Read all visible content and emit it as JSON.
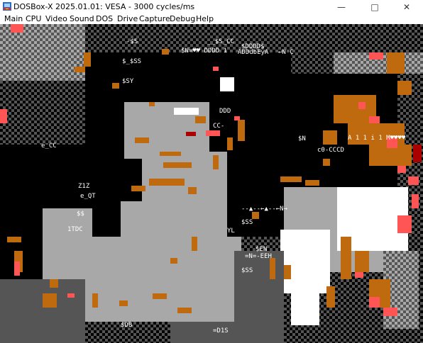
{
  "window": {
    "title": "DOSBox-X 2025.01.01: VESA - 3000 cycles/ms",
    "min_glyph": "—",
    "max_glyph": "□",
    "close_glyph": "✕"
  },
  "menu": {
    "items": [
      {
        "label": "Main"
      },
      {
        "label": "CPU"
      },
      {
        "label": "Video"
      },
      {
        "label": "Sound"
      },
      {
        "label": "DOS"
      },
      {
        "label": "Drive"
      },
      {
        "label": "Capture"
      },
      {
        "label": "Debug"
      },
      {
        "label": "Help"
      }
    ]
  },
  "display": {
    "palette": {
      "black": "#000000",
      "dark_gray": "#555555",
      "gray": "#a8a8a8",
      "white": "#ffffff",
      "brown": "#c06a10",
      "light_red": "#ff5555",
      "red": "#aa0000"
    },
    "text_fragments": [
      {
        "text": "-$S",
        "color": "#ffffff"
      },
      {
        "text": "__$S_CC",
        "color": "#ffffff"
      },
      {
        "text": "$DDDD$",
        "color": "#ffffff"
      },
      {
        "text": "$N=♥♥ DDDD 1",
        "color": "#ffffff"
      },
      {
        "text": "ADDdbEyA",
        "color": "#ffffff"
      },
      {
        "text": "←N C",
        "color": "#ffffff"
      },
      {
        "text": "$_$SS",
        "color": "#ffffff"
      },
      {
        "text": "$SY",
        "color": "#ffffff"
      },
      {
        "text": "DDD",
        "color": "#ffffff"
      },
      {
        "text": "CC-",
        "color": "#ffffff"
      },
      {
        "text": "e_CC",
        "color": "#ffffff"
      },
      {
        "text": "$N",
        "color": "#ffffff"
      },
      {
        "text": "c0-CCCD",
        "color": "#ffffff"
      },
      {
        "text": "A 1 1 i 1 M♥♥♥♥",
        "color": "#ffffff"
      },
      {
        "text": "Z1Z",
        "color": "#ffffff"
      },
      {
        "text": "e_QT",
        "color": "#ffffff"
      },
      {
        "text": "$$",
        "color": "#ffffff"
      },
      {
        "text": "1TDC",
        "color": "#ffffff"
      },
      {
        "text": "--▲--←▲--←N→",
        "color": "#ffffff"
      },
      {
        "text": "YL",
        "color": "#ffffff"
      },
      {
        "text": "$SS",
        "color": "#ffffff"
      },
      {
        "text": "$EN",
        "color": "#ffffff"
      },
      {
        "text": "=N=-EEH",
        "color": "#ffffff"
      },
      {
        "text": "$SS",
        "color": "#ffffff"
      },
      {
        "text": "CCC-C",
        "color": "#ffffff"
      },
      {
        "text": "$DB",
        "color": "#ffffff"
      },
      {
        "text": "=D1S",
        "color": "#ffffff"
      }
    ]
  }
}
